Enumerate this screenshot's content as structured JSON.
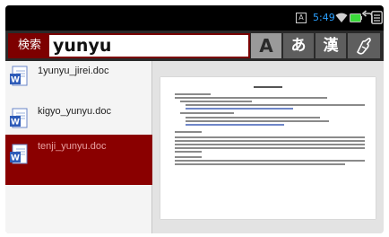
{
  "status_bar": {
    "indicator": "A",
    "time": "5:49",
    "icons": [
      "wifi-icon",
      "battery-icon",
      "back-icon",
      "menu-icon"
    ]
  },
  "search": {
    "label": "検索",
    "value": "yunyu"
  },
  "input_modes": [
    {
      "label": "A"
    },
    {
      "label": "あ"
    },
    {
      "label": "漢"
    },
    {
      "label": "handwriting-icon"
    }
  ],
  "files": [
    {
      "name": "1yunyu_jirei.doc",
      "selected": false
    },
    {
      "name": "kigyo_yunyu.doc",
      "selected": false
    },
    {
      "name": "tenji_yunyu.doc",
      "selected": true
    }
  ],
  "colors": {
    "accent": "#8a0000",
    "status_time": "#2aa0ff",
    "battery": "#3ad83a"
  }
}
